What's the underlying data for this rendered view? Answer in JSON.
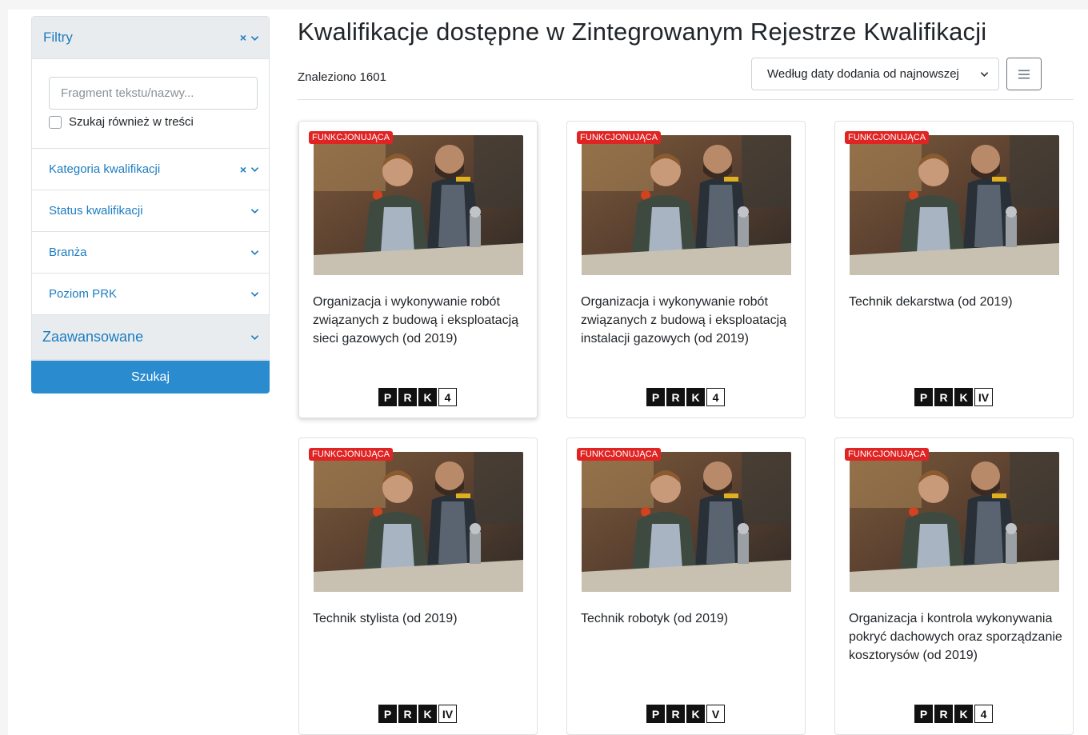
{
  "sidebar": {
    "header_title": "Filtry",
    "search_placeholder": "Fragment tekstu/nazwy...",
    "search_value": "",
    "search_in_content_label": "Szukaj również w treści",
    "filters": [
      {
        "label": "Kategoria kwalifikacji",
        "clearable": true
      },
      {
        "label": "Status kwalifikacji",
        "clearable": false
      },
      {
        "label": "Branża",
        "clearable": false
      },
      {
        "label": "Poziom PRK",
        "clearable": false
      }
    ],
    "advanced_label": "Zaawansowane",
    "submit_label": "Szukaj",
    "clear_glyph": "×"
  },
  "main": {
    "title": "Kwalifikacje dostępne w Zintegrowanym Rejestrze Kwalifikacji",
    "found_text": "Znaleziono 1601",
    "sort_selected": "Według daty dodania od najnowszej",
    "view_list_icon": "list-icon",
    "view_grid_icon": "grid-icon",
    "active_view": "grid"
  },
  "cards": [
    {
      "status": "FUNKCJONUJĄCA",
      "title": "Organizacja i wykonywanie robót związanych z budową i eksploatacją sieci gazowych (od 2019)",
      "prk_letters": [
        "P",
        "R",
        "K"
      ],
      "prk_level": "4"
    },
    {
      "status": "FUNKCJONUJĄCA",
      "title": "Organizacja i wykonywanie robót związanych z budową i eksploatacją instalacji gazowych (od 2019)",
      "prk_letters": [
        "P",
        "R",
        "K"
      ],
      "prk_level": "4"
    },
    {
      "status": "FUNKCJONUJĄCA",
      "title": "Technik dekarstwa (od 2019)",
      "prk_letters": [
        "P",
        "R",
        "K"
      ],
      "prk_level": "IV"
    },
    {
      "status": "FUNKCJONUJĄCA",
      "title": "Technik stylista (od 2019)",
      "prk_letters": [
        "P",
        "R",
        "K"
      ],
      "prk_level": "IV"
    },
    {
      "status": "FUNKCJONUJĄCA",
      "title": "Technik robotyk (od 2019)",
      "prk_letters": [
        "P",
        "R",
        "K"
      ],
      "prk_level": "V"
    },
    {
      "status": "FUNKCJONUJĄCA",
      "title": "Organizacja i kontrola wykonywania pokryć dachowych oraz sporządzanie kosztorysów (od 2019)",
      "prk_letters": [
        "P",
        "R",
        "K"
      ],
      "prk_level": "4"
    }
  ],
  "colors": {
    "link_blue": "#1c7cc0",
    "button_blue": "#2a8bce",
    "badge_red": "#e02424",
    "grid_active": "#6c757d"
  }
}
